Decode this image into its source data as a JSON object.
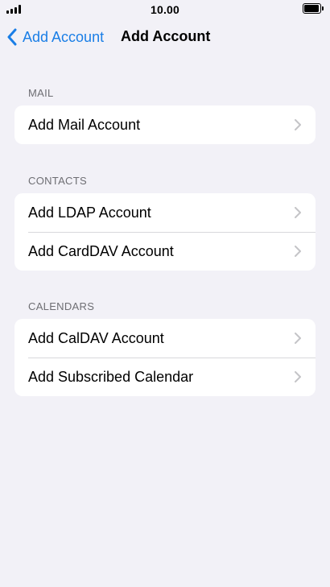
{
  "status_bar": {
    "time": "10.00",
    "signal_icon": "signal-bars-icon",
    "battery_icon": "battery-icon"
  },
  "nav": {
    "back_label": "Add Account",
    "back_icon": "chevron-left-icon",
    "title": "Add Account",
    "accent_color": "#1a7ee6"
  },
  "sections": {
    "mail": {
      "header": "MAIL",
      "items": [
        {
          "label": "Add Mail Account"
        }
      ]
    },
    "contacts": {
      "header": "CONTACTS",
      "items": [
        {
          "label": "Add LDAP Account"
        },
        {
          "label": "Add CardDAV Account"
        }
      ]
    },
    "calendars": {
      "header": "CALENDARS",
      "items": [
        {
          "label": "Add CalDAV Account"
        },
        {
          "label": "Add Subscribed Calendar"
        }
      ]
    }
  },
  "colors": {
    "background": "#f2f1f7",
    "card": "#ffffff",
    "section_header": "#6e6e73",
    "separator": "#d8d8dc",
    "chevron": "#c4c4c7"
  }
}
